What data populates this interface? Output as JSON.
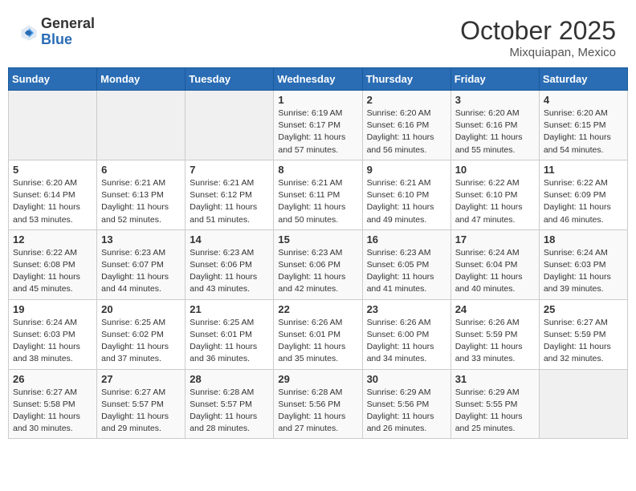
{
  "header": {
    "logo_general": "General",
    "logo_blue": "Blue",
    "month_title": "October 2025",
    "location": "Mixquiapan, Mexico"
  },
  "weekdays": [
    "Sunday",
    "Monday",
    "Tuesday",
    "Wednesday",
    "Thursday",
    "Friday",
    "Saturday"
  ],
  "weeks": [
    [
      {
        "day": "",
        "info": ""
      },
      {
        "day": "",
        "info": ""
      },
      {
        "day": "",
        "info": ""
      },
      {
        "day": "1",
        "info": "Sunrise: 6:19 AM\nSunset: 6:17 PM\nDaylight: 11 hours and 57 minutes."
      },
      {
        "day": "2",
        "info": "Sunrise: 6:20 AM\nSunset: 6:16 PM\nDaylight: 11 hours and 56 minutes."
      },
      {
        "day": "3",
        "info": "Sunrise: 6:20 AM\nSunset: 6:16 PM\nDaylight: 11 hours and 55 minutes."
      },
      {
        "day": "4",
        "info": "Sunrise: 6:20 AM\nSunset: 6:15 PM\nDaylight: 11 hours and 54 minutes."
      }
    ],
    [
      {
        "day": "5",
        "info": "Sunrise: 6:20 AM\nSunset: 6:14 PM\nDaylight: 11 hours and 53 minutes."
      },
      {
        "day": "6",
        "info": "Sunrise: 6:21 AM\nSunset: 6:13 PM\nDaylight: 11 hours and 52 minutes."
      },
      {
        "day": "7",
        "info": "Sunrise: 6:21 AM\nSunset: 6:12 PM\nDaylight: 11 hours and 51 minutes."
      },
      {
        "day": "8",
        "info": "Sunrise: 6:21 AM\nSunset: 6:11 PM\nDaylight: 11 hours and 50 minutes."
      },
      {
        "day": "9",
        "info": "Sunrise: 6:21 AM\nSunset: 6:10 PM\nDaylight: 11 hours and 49 minutes."
      },
      {
        "day": "10",
        "info": "Sunrise: 6:22 AM\nSunset: 6:10 PM\nDaylight: 11 hours and 47 minutes."
      },
      {
        "day": "11",
        "info": "Sunrise: 6:22 AM\nSunset: 6:09 PM\nDaylight: 11 hours and 46 minutes."
      }
    ],
    [
      {
        "day": "12",
        "info": "Sunrise: 6:22 AM\nSunset: 6:08 PM\nDaylight: 11 hours and 45 minutes."
      },
      {
        "day": "13",
        "info": "Sunrise: 6:23 AM\nSunset: 6:07 PM\nDaylight: 11 hours and 44 minutes."
      },
      {
        "day": "14",
        "info": "Sunrise: 6:23 AM\nSunset: 6:06 PM\nDaylight: 11 hours and 43 minutes."
      },
      {
        "day": "15",
        "info": "Sunrise: 6:23 AM\nSunset: 6:06 PM\nDaylight: 11 hours and 42 minutes."
      },
      {
        "day": "16",
        "info": "Sunrise: 6:23 AM\nSunset: 6:05 PM\nDaylight: 11 hours and 41 minutes."
      },
      {
        "day": "17",
        "info": "Sunrise: 6:24 AM\nSunset: 6:04 PM\nDaylight: 11 hours and 40 minutes."
      },
      {
        "day": "18",
        "info": "Sunrise: 6:24 AM\nSunset: 6:03 PM\nDaylight: 11 hours and 39 minutes."
      }
    ],
    [
      {
        "day": "19",
        "info": "Sunrise: 6:24 AM\nSunset: 6:03 PM\nDaylight: 11 hours and 38 minutes."
      },
      {
        "day": "20",
        "info": "Sunrise: 6:25 AM\nSunset: 6:02 PM\nDaylight: 11 hours and 37 minutes."
      },
      {
        "day": "21",
        "info": "Sunrise: 6:25 AM\nSunset: 6:01 PM\nDaylight: 11 hours and 36 minutes."
      },
      {
        "day": "22",
        "info": "Sunrise: 6:26 AM\nSunset: 6:01 PM\nDaylight: 11 hours and 35 minutes."
      },
      {
        "day": "23",
        "info": "Sunrise: 6:26 AM\nSunset: 6:00 PM\nDaylight: 11 hours and 34 minutes."
      },
      {
        "day": "24",
        "info": "Sunrise: 6:26 AM\nSunset: 5:59 PM\nDaylight: 11 hours and 33 minutes."
      },
      {
        "day": "25",
        "info": "Sunrise: 6:27 AM\nSunset: 5:59 PM\nDaylight: 11 hours and 32 minutes."
      }
    ],
    [
      {
        "day": "26",
        "info": "Sunrise: 6:27 AM\nSunset: 5:58 PM\nDaylight: 11 hours and 30 minutes."
      },
      {
        "day": "27",
        "info": "Sunrise: 6:27 AM\nSunset: 5:57 PM\nDaylight: 11 hours and 29 minutes."
      },
      {
        "day": "28",
        "info": "Sunrise: 6:28 AM\nSunset: 5:57 PM\nDaylight: 11 hours and 28 minutes."
      },
      {
        "day": "29",
        "info": "Sunrise: 6:28 AM\nSunset: 5:56 PM\nDaylight: 11 hours and 27 minutes."
      },
      {
        "day": "30",
        "info": "Sunrise: 6:29 AM\nSunset: 5:56 PM\nDaylight: 11 hours and 26 minutes."
      },
      {
        "day": "31",
        "info": "Sunrise: 6:29 AM\nSunset: 5:55 PM\nDaylight: 11 hours and 25 minutes."
      },
      {
        "day": "",
        "info": ""
      }
    ]
  ]
}
